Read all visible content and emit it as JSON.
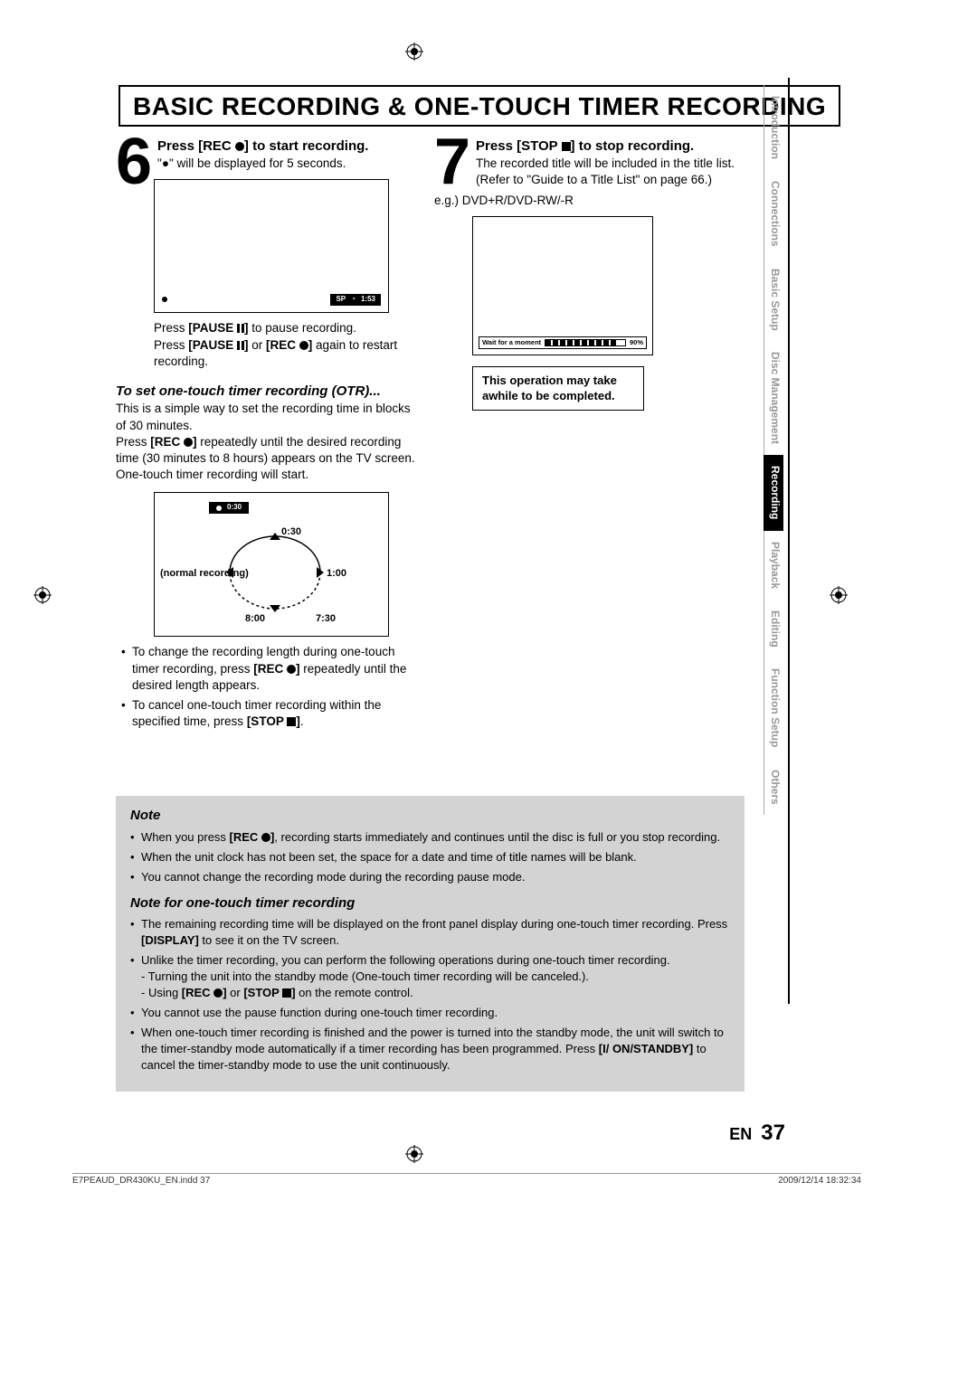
{
  "page_title": "BASIC RECORDING & ONE-TOUCH TIMER RECORDING",
  "side_tabs": [
    "Introduction",
    "Connections",
    "Basic Setup",
    "Disc Management",
    "Recording",
    "Playback",
    "Editing",
    "Function Setup",
    "Others"
  ],
  "active_tab": "Recording",
  "step6": {
    "num": "6",
    "title_a": "Press [REC ",
    "title_b": "] to start recording.",
    "line1": "\"●\" will be displayed for 5 seconds.",
    "bar": {
      "sp": "SP",
      "time": "1:53"
    },
    "pause_a": "Press ",
    "pause_b": "[PAUSE ",
    "pause_c": "] ",
    "pause_d": " to pause recording.",
    "restart_a": "Press ",
    "restart_b": "[PAUSE ",
    "restart_c": "] ",
    "restart_d": " or ",
    "restart_e": "[REC ",
    "restart_f": "] ",
    "restart_g": " again to restart recording."
  },
  "otr": {
    "heading": "To set one-touch timer recording (OTR)...",
    "p1": "This is a simple way to set the recording time in blocks of 30 minutes.",
    "p2_a": "Press ",
    "p2_b": "[REC ",
    "p2_c": "]",
    "p2_d": " repeatedly until the desired recording time (30 minutes to 8 hours) appears on the TV screen. One-touch timer recording will start.",
    "mini_time": "0:30",
    "labels": {
      "t030": "0:30",
      "normal": "(normal recording)",
      "t100": "1:00",
      "t800": "8:00",
      "t730": "7:30"
    },
    "b1_a": "To change the recording length during one-touch timer recording, press ",
    "b1_b": "[REC ",
    "b1_c": "]",
    "b1_d": " repeatedly until the desired length appears.",
    "b2_a": "To cancel one-touch timer recording within the specified time, press ",
    "b2_b": "[STOP ",
    "b2_c": "]",
    "b2_d": "."
  },
  "step7": {
    "num": "7",
    "title_a": "Press [STOP ",
    "title_b": "] to stop recording.",
    "l1": "The recorded title will be included in the title list.",
    "l2": "(Refer to \"Guide to a Title List\" on page 66.)",
    "l3": "e.g.) DVD+R/DVD-RW/-R",
    "progress_label": "Wait for a moment",
    "progress_pct": "90%",
    "warn": "This operation may take awhile to be completed."
  },
  "notes": {
    "hd": "Note",
    "n1_a": "When you press ",
    "n1_b": "[REC ",
    "n1_c": "]",
    "n1_d": ", recording starts immediately and continues until the disc is full or you stop recording.",
    "n2": "When the unit clock has not been set, the space for a date and time of title names will be blank.",
    "n3": "You cannot change the recording mode during the recording pause mode.",
    "sub_hd": "Note for one-touch timer recording",
    "s1_a": "The remaining recording time will be displayed on the front panel display during one-touch timer recording. Press ",
    "s1_b": "[DISPLAY]",
    "s1_c": " to see it on the TV screen.",
    "s2": "Unlike the timer recording, you can perform the following operations during one-touch timer recording.",
    "s2a": "- Turning the unit into the standby mode (One-touch timer recording will be canceled.).",
    "s2b_a": "- Using ",
    "s2b_b": "[REC ",
    "s2b_c": "]",
    "s2b_d": " or ",
    "s2b_e": "[STOP ",
    "s2b_f": "]",
    "s2b_g": " on the remote control.",
    "s3": "You cannot use the pause function during one-touch timer recording.",
    "s4_a": "When one-touch timer recording is finished and the power is turned into the standby mode, the unit will switch to the timer-standby mode automatically if a timer recording has been programmed. Press ",
    "s4_b": "[I/ ON/STANDBY]",
    "s4_c": " to cancel the timer-standby mode to use the unit continuously."
  },
  "page_num": {
    "en": "EN",
    "num": "37"
  },
  "footer": {
    "left": "E7PEAUD_DR430KU_EN.indd   37",
    "right": "2009/12/14   18:32:34"
  }
}
